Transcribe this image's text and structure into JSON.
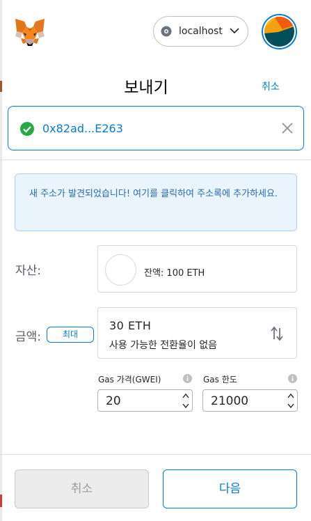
{
  "header": {
    "network_label": "localhost",
    "icons": {
      "logo": "metamask-fox-icon",
      "network": "network-status-icon",
      "dropdown": "chevron-down-icon",
      "account": "account-avatar"
    }
  },
  "page": {
    "title": "보내기",
    "cancel_label": "취소"
  },
  "recipient": {
    "address": "0x82ad...E263",
    "check_icon": "check-circle-icon",
    "clear_icon": "close-icon"
  },
  "banner": {
    "text": "새 주소가 발견되었습니다! 여기를 클릭하여 주소록에 추가하세요."
  },
  "asset": {
    "label": "자산:",
    "balance": "잔액: 100 ETH"
  },
  "amount": {
    "label": "금액:",
    "max_label": "최대",
    "value": "30  ETH",
    "conversion_note": "사용 가능한 전환율이 없음",
    "swap_icon": "swap-arrows-icon"
  },
  "gas": {
    "price_label": "Gas 가격(GWEI)",
    "price_value": "20",
    "limit_label": "Gas 한도",
    "limit_value": "21000",
    "info_icon": "info-icon"
  },
  "footer": {
    "cancel_label": "취소",
    "next_label": "다음"
  },
  "colors": {
    "accent": "#037dd6",
    "success": "#28a745",
    "banner_bg": "#e9f4fd"
  }
}
